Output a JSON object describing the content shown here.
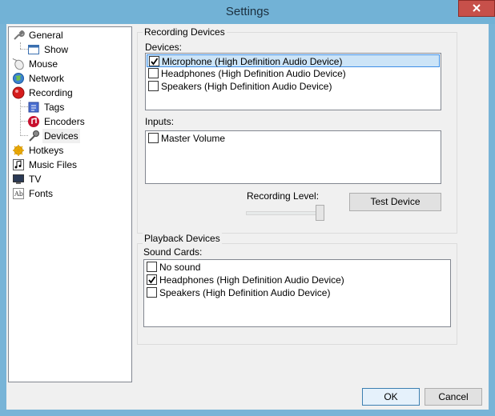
{
  "window": {
    "title": "Settings"
  },
  "tree": {
    "items": [
      {
        "label": "General",
        "icon": "wrench-icon"
      },
      {
        "label": "Show",
        "icon": "window-icon"
      },
      {
        "label": "Mouse",
        "icon": "mouse-icon"
      },
      {
        "label": "Network",
        "icon": "globe-icon"
      },
      {
        "label": "Recording",
        "icon": "record-icon"
      },
      {
        "label": "Tags",
        "icon": "tag-icon"
      },
      {
        "label": "Encoders",
        "icon": "encoder-icon"
      },
      {
        "label": "Devices",
        "icon": "microphone-icon"
      },
      {
        "label": "Hotkeys",
        "icon": "hotkeys-icon"
      },
      {
        "label": "Music Files",
        "icon": "music-note-icon"
      },
      {
        "label": "TV",
        "icon": "tv-icon"
      },
      {
        "label": "Fonts",
        "icon": "font-icon"
      }
    ],
    "selected": "Devices"
  },
  "recording": {
    "group_title": "Recording Devices",
    "devices_label": "Devices:",
    "devices": [
      {
        "label": "Microphone (High Definition Audio Device)",
        "checked": true
      },
      {
        "label": "Headphones (High Definition Audio Device)",
        "checked": false
      },
      {
        "label": "Speakers (High Definition Audio Device)",
        "checked": false
      }
    ],
    "inputs_label": "Inputs:",
    "inputs": [
      {
        "label": "Master Volume",
        "checked": false
      }
    ],
    "level_label": "Recording Level:",
    "level": 1.0,
    "test_button": "Test Device"
  },
  "playback": {
    "group_title": "Playback Devices",
    "cards_label": "Sound Cards:",
    "cards": [
      {
        "label": "No sound",
        "checked": false
      },
      {
        "label": "Headphones (High Definition Audio Device)",
        "checked": true
      },
      {
        "label": "Speakers (High Definition Audio Device)",
        "checked": false
      }
    ]
  },
  "buttons": {
    "ok": "OK",
    "cancel": "Cancel"
  },
  "colors": {
    "title_bar": "#72b2d6",
    "close": "#c7504a",
    "selection": "#cce4f7"
  }
}
